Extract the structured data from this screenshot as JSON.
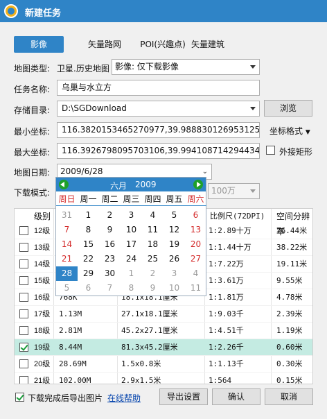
{
  "window": {
    "title": "新建任务",
    "logo_icon": "globe-icon"
  },
  "tabs": [
    {
      "label": "影像",
      "active": true
    },
    {
      "label": "矢量路网",
      "active": false
    },
    {
      "label": "POI(兴趣点)",
      "active": false
    },
    {
      "label": "矢量建筑",
      "active": false
    }
  ],
  "form": {
    "map_type_label": "地图类型:",
    "map_type_value": "卫星.历史地图",
    "download_mode_combo": "影像: 仅下载影像",
    "task_name_label": "任务名称:",
    "task_name_value": "乌巢与水立方",
    "storage_label": "存储目录:",
    "storage_value": "D:\\SGDownload",
    "browse_button": "浏览",
    "min_coord_label": "最小坐标:",
    "min_coord_value": "116.3820153465270977,39.9888301269531254",
    "coord_format_button": "坐标格式",
    "max_coord_label": "最大坐标:",
    "max_coord_value": "116.3926798095703106,39.9941087142944340",
    "bbox_checkbox_label": "外接矩形",
    "bbox_checked": false,
    "map_date_label": "地图日期:",
    "map_date_value": "2009/6/28",
    "download_mode_label": "下载模式:",
    "hidden_combo_value": "100万"
  },
  "calendar": {
    "month": "六月",
    "year": "2009",
    "weekdays": [
      "周日",
      "周一",
      "周二",
      "周三",
      "周四",
      "周五",
      "周六"
    ],
    "rows": [
      [
        {
          "d": "31",
          "g": true
        },
        {
          "d": "1"
        },
        {
          "d": "2"
        },
        {
          "d": "3"
        },
        {
          "d": "4"
        },
        {
          "d": "5"
        },
        {
          "d": "6"
        }
      ],
      [
        {
          "d": "7"
        },
        {
          "d": "8"
        },
        {
          "d": "9"
        },
        {
          "d": "10"
        },
        {
          "d": "11"
        },
        {
          "d": "12"
        },
        {
          "d": "13"
        }
      ],
      [
        {
          "d": "14"
        },
        {
          "d": "15"
        },
        {
          "d": "16"
        },
        {
          "d": "17"
        },
        {
          "d": "18"
        },
        {
          "d": "19"
        },
        {
          "d": "20"
        }
      ],
      [
        {
          "d": "21"
        },
        {
          "d": "22"
        },
        {
          "d": "23"
        },
        {
          "d": "24"
        },
        {
          "d": "25"
        },
        {
          "d": "26"
        },
        {
          "d": "27"
        }
      ],
      [
        {
          "d": "28",
          "today": true
        },
        {
          "d": "29"
        },
        {
          "d": "30"
        },
        {
          "d": "1",
          "g": true
        },
        {
          "d": "2",
          "g": true
        },
        {
          "d": "3",
          "g": true
        },
        {
          "d": "4",
          "g": true
        }
      ],
      [
        {
          "d": "5",
          "g": true
        },
        {
          "d": "6",
          "g": true
        },
        {
          "d": "7",
          "g": true
        },
        {
          "d": "8",
          "g": true
        },
        {
          "d": "9",
          "g": true
        },
        {
          "d": "10",
          "g": true
        },
        {
          "d": "11",
          "g": true
        }
      ]
    ]
  },
  "grid": {
    "headers": [
      "级别",
      "",
      "",
      "比例尺(72DPI)",
      "空间分辨率"
    ],
    "rows": [
      {
        "level": "12级",
        "size": "",
        "dims": "",
        "scale": "1:2.89十万",
        "res": "76.44米",
        "checked": false,
        "selected": false
      },
      {
        "level": "13级",
        "size": "",
        "dims": "",
        "scale": "1:1.44十万",
        "res": "38.22米",
        "checked": false,
        "selected": false
      },
      {
        "level": "14级",
        "size": "",
        "dims": "",
        "scale": "1:7.22万",
        "res": "19.11米",
        "checked": false,
        "selected": false
      },
      {
        "level": "15级",
        "size": "",
        "dims": "",
        "scale": "1:3.61万",
        "res": "9.55米",
        "checked": false,
        "selected": false
      },
      {
        "level": "16级",
        "size": "768K",
        "dims": "18.1x18.1厘米",
        "scale": "1:1.81万",
        "res": "4.78米",
        "checked": false,
        "selected": false
      },
      {
        "level": "17级",
        "size": "1.13M",
        "dims": "27.1x18.1厘米",
        "scale": "1:9.03千",
        "res": "2.39米",
        "checked": false,
        "selected": false
      },
      {
        "level": "18级",
        "size": "2.81M",
        "dims": "45.2x27.1厘米",
        "scale": "1:4.51千",
        "res": "1.19米",
        "checked": false,
        "selected": false
      },
      {
        "level": "19级",
        "size": "8.44M",
        "dims": "81.3x45.2厘米",
        "scale": "1:2.26千",
        "res": "0.60米",
        "checked": true,
        "selected": true
      },
      {
        "level": "20级",
        "size": "28.69M",
        "dims": "1.5x0.8米",
        "scale": "1:1.13千",
        "res": "0.30米",
        "checked": false,
        "selected": false
      },
      {
        "level": "21级",
        "size": "102.00M",
        "dims": "2.9x1.5米",
        "scale": "1:564",
        "res": "0.15米",
        "checked": false,
        "selected": false
      }
    ]
  },
  "footer": {
    "export_checkbox_label": "下载完成后导出图片",
    "export_checked": true,
    "help_link": "在线帮助",
    "export_settings_button": "导出设置",
    "confirm_button": "确认",
    "cancel_button": "取消"
  },
  "colors": {
    "accent": "#2f84c7",
    "selected_row": "#c4ebe2",
    "weekend_red": "#d42b2b"
  }
}
